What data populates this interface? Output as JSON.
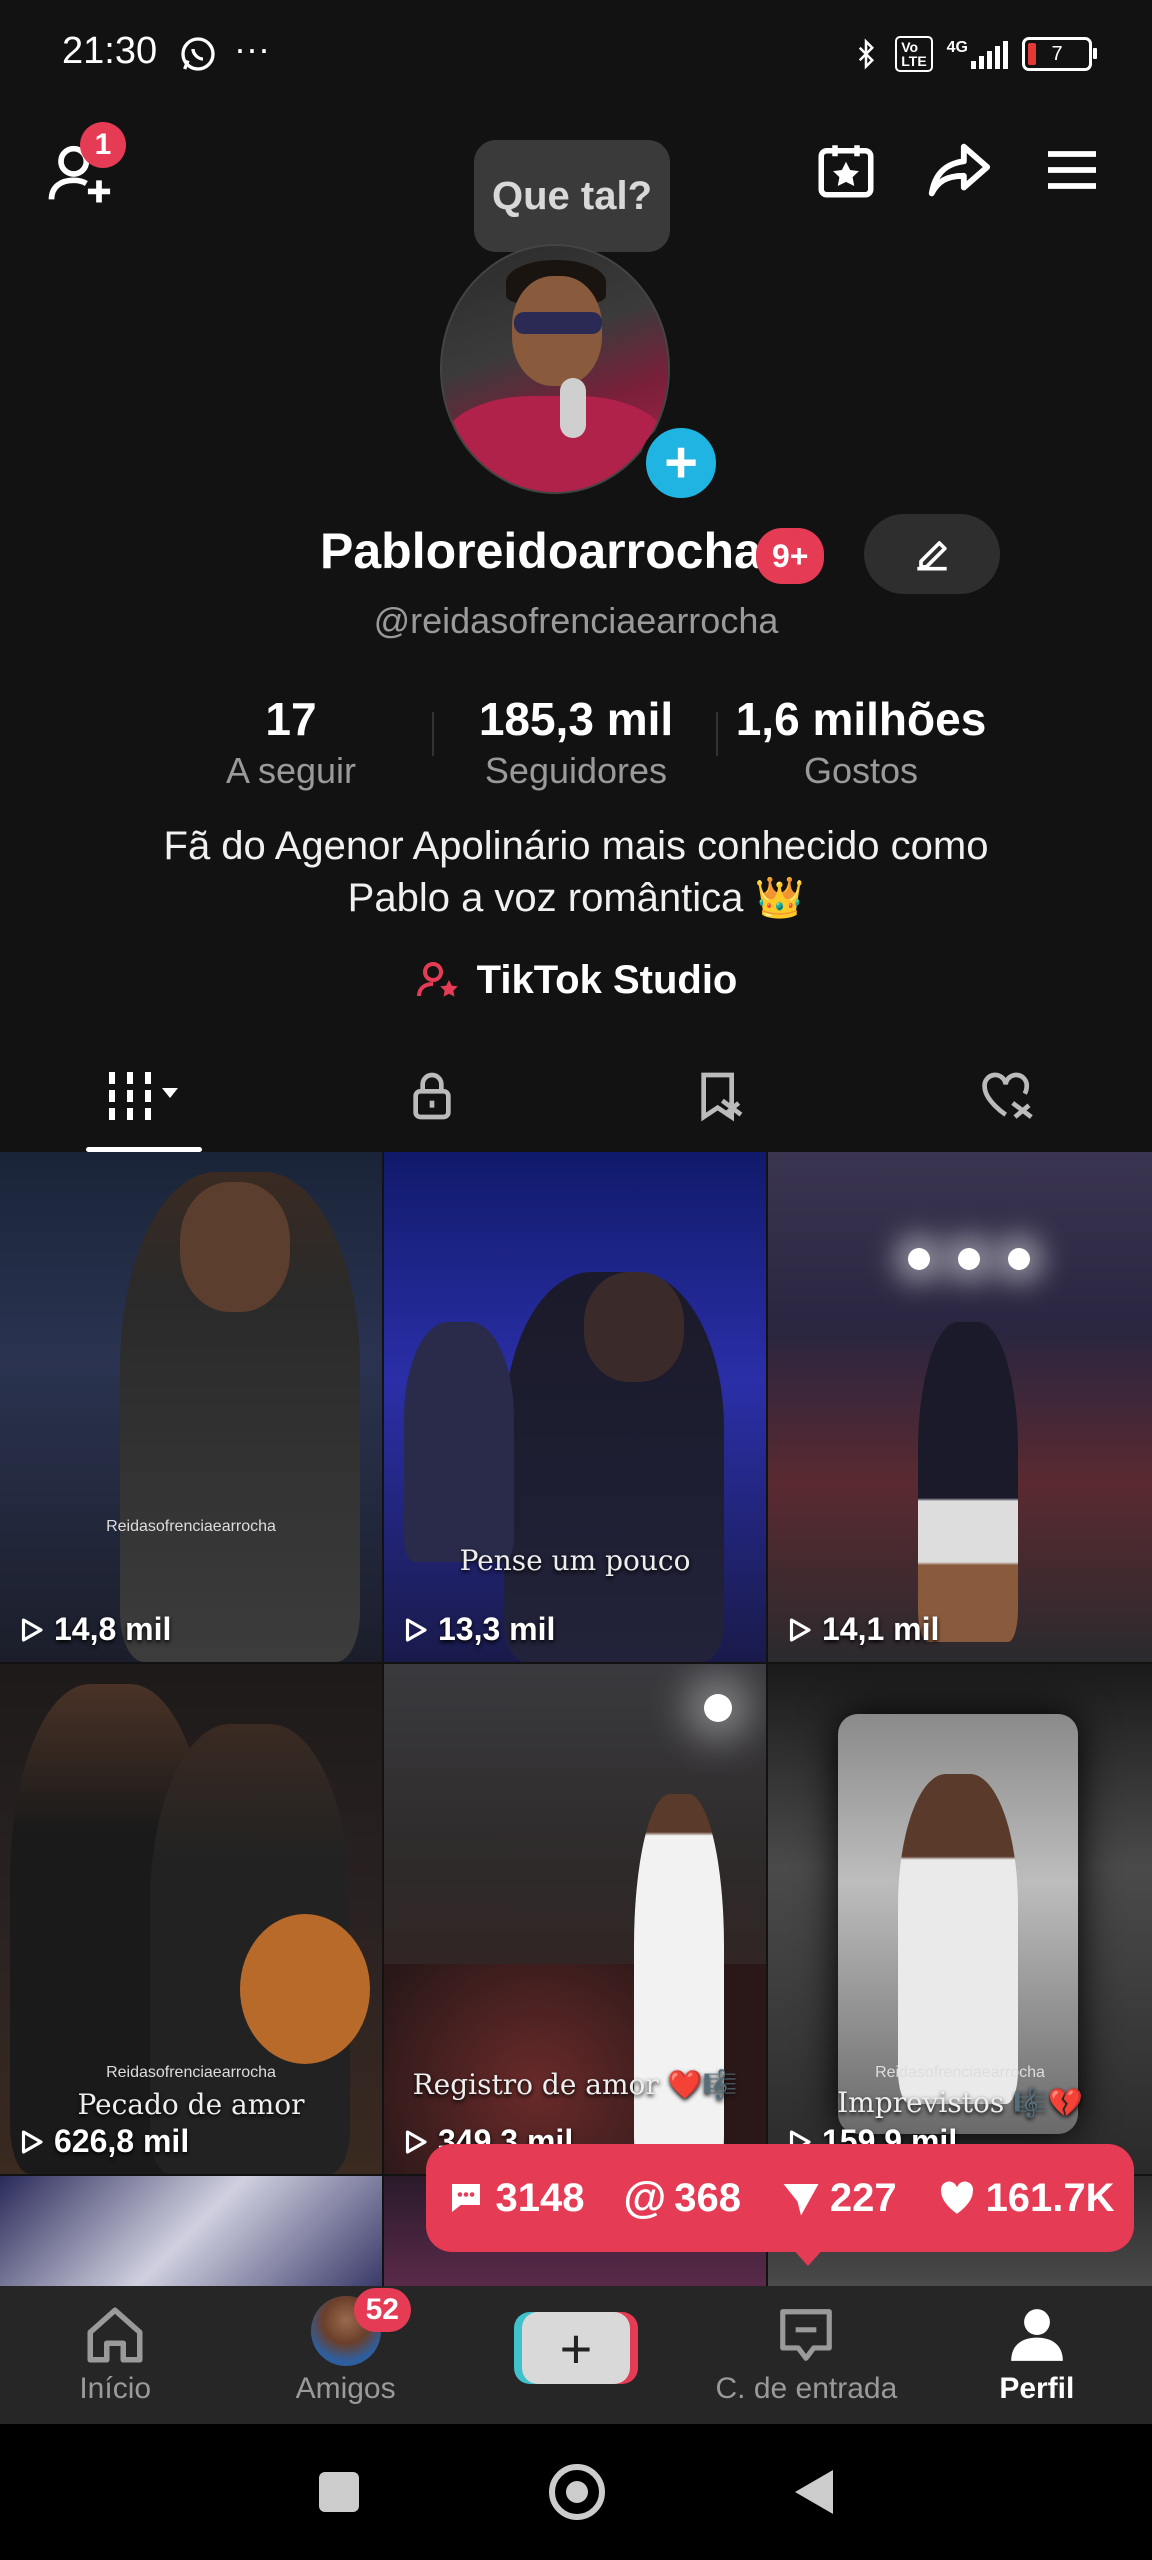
{
  "status_bar": {
    "time": "21:30",
    "network": "4G",
    "battery": "7",
    "icons": [
      "whatsapp-icon",
      "more-icon",
      "bluetooth-icon",
      "volte-icon",
      "signal-icon",
      "battery-icon"
    ]
  },
  "top_bar": {
    "add_friend_badge": "1",
    "tooltip": "Que tal?",
    "icons": [
      "add-friend-icon",
      "calendar-star-icon",
      "share-icon",
      "menu-icon"
    ]
  },
  "profile": {
    "display_name": "Pabloreidoarrocha",
    "name_badge": "9+",
    "handle": "@reidasofrenciaearrocha",
    "stats": [
      {
        "value": "17",
        "label": "A seguir"
      },
      {
        "value": "185,3 mil",
        "label": "Seguidores"
      },
      {
        "value": "1,6 milhões",
        "label": "Gostos"
      }
    ],
    "bio_line1": "Fã do Agenor Apolinário mais conhecido como",
    "bio_line2": "Pablo a voz romântica 👑",
    "studio_link": "TikTok Studio"
  },
  "tabs": [
    "videos-grid",
    "private",
    "reposts",
    "liked"
  ],
  "videos": [
    {
      "views": "14,8 mil",
      "caption": "",
      "watermark": "Reidasofrenciaearrocha",
      "bg": "linear-gradient(180deg,#1a2438 0%,#2a3350 40%,#1b1e2a 100%)"
    },
    {
      "views": "13,3 mil",
      "caption": "Pense um pouco",
      "watermark": "",
      "bg": "linear-gradient(180deg,#101a6a 0%,#2a2fa8 45%,#191a4a 100%)"
    },
    {
      "views": "14,1 mil",
      "caption": "",
      "watermark": "",
      "bg": "linear-gradient(180deg,#3a3550 0%,#2a2540 35%,#5a2a30 65%,#2a2a2e 100%)"
    },
    {
      "views": "626,8 mil",
      "caption": "Pecado de amor",
      "watermark": "Reidasofrenciaearrocha",
      "bg": "linear-gradient(180deg,#1e1a1a 0%,#2a2222 50%,#3a2a20 100%)"
    },
    {
      "views": "349,3 mil",
      "caption": "Registro de amor ❤️🎼",
      "watermark": "",
      "bg": "linear-gradient(180deg,#3a3a3e 0%,#2e2a2a 40%,#3a1a1a 100%)"
    },
    {
      "views": "159,9 mil",
      "caption": "Imprevistos 🎼💔",
      "watermark": "Reidasofrenciaearrocha",
      "bg": "linear-gradient(180deg,#1a1a1a 0%,#4a4a4a 40%,#2a2a2a 100%)"
    }
  ],
  "engagement": {
    "comments": "3148",
    "mentions": "368",
    "shares": "227",
    "likes": "161.7K"
  },
  "bottom_nav": [
    {
      "label": "Início",
      "icon": "home-icon"
    },
    {
      "label": "Amigos",
      "icon": "friends-avatar",
      "badge": "52"
    },
    {
      "label": "",
      "icon": "create-icon"
    },
    {
      "label": "C. de entrada",
      "icon": "inbox-icon"
    },
    {
      "label": "Perfil",
      "icon": "profile-icon"
    }
  ]
}
